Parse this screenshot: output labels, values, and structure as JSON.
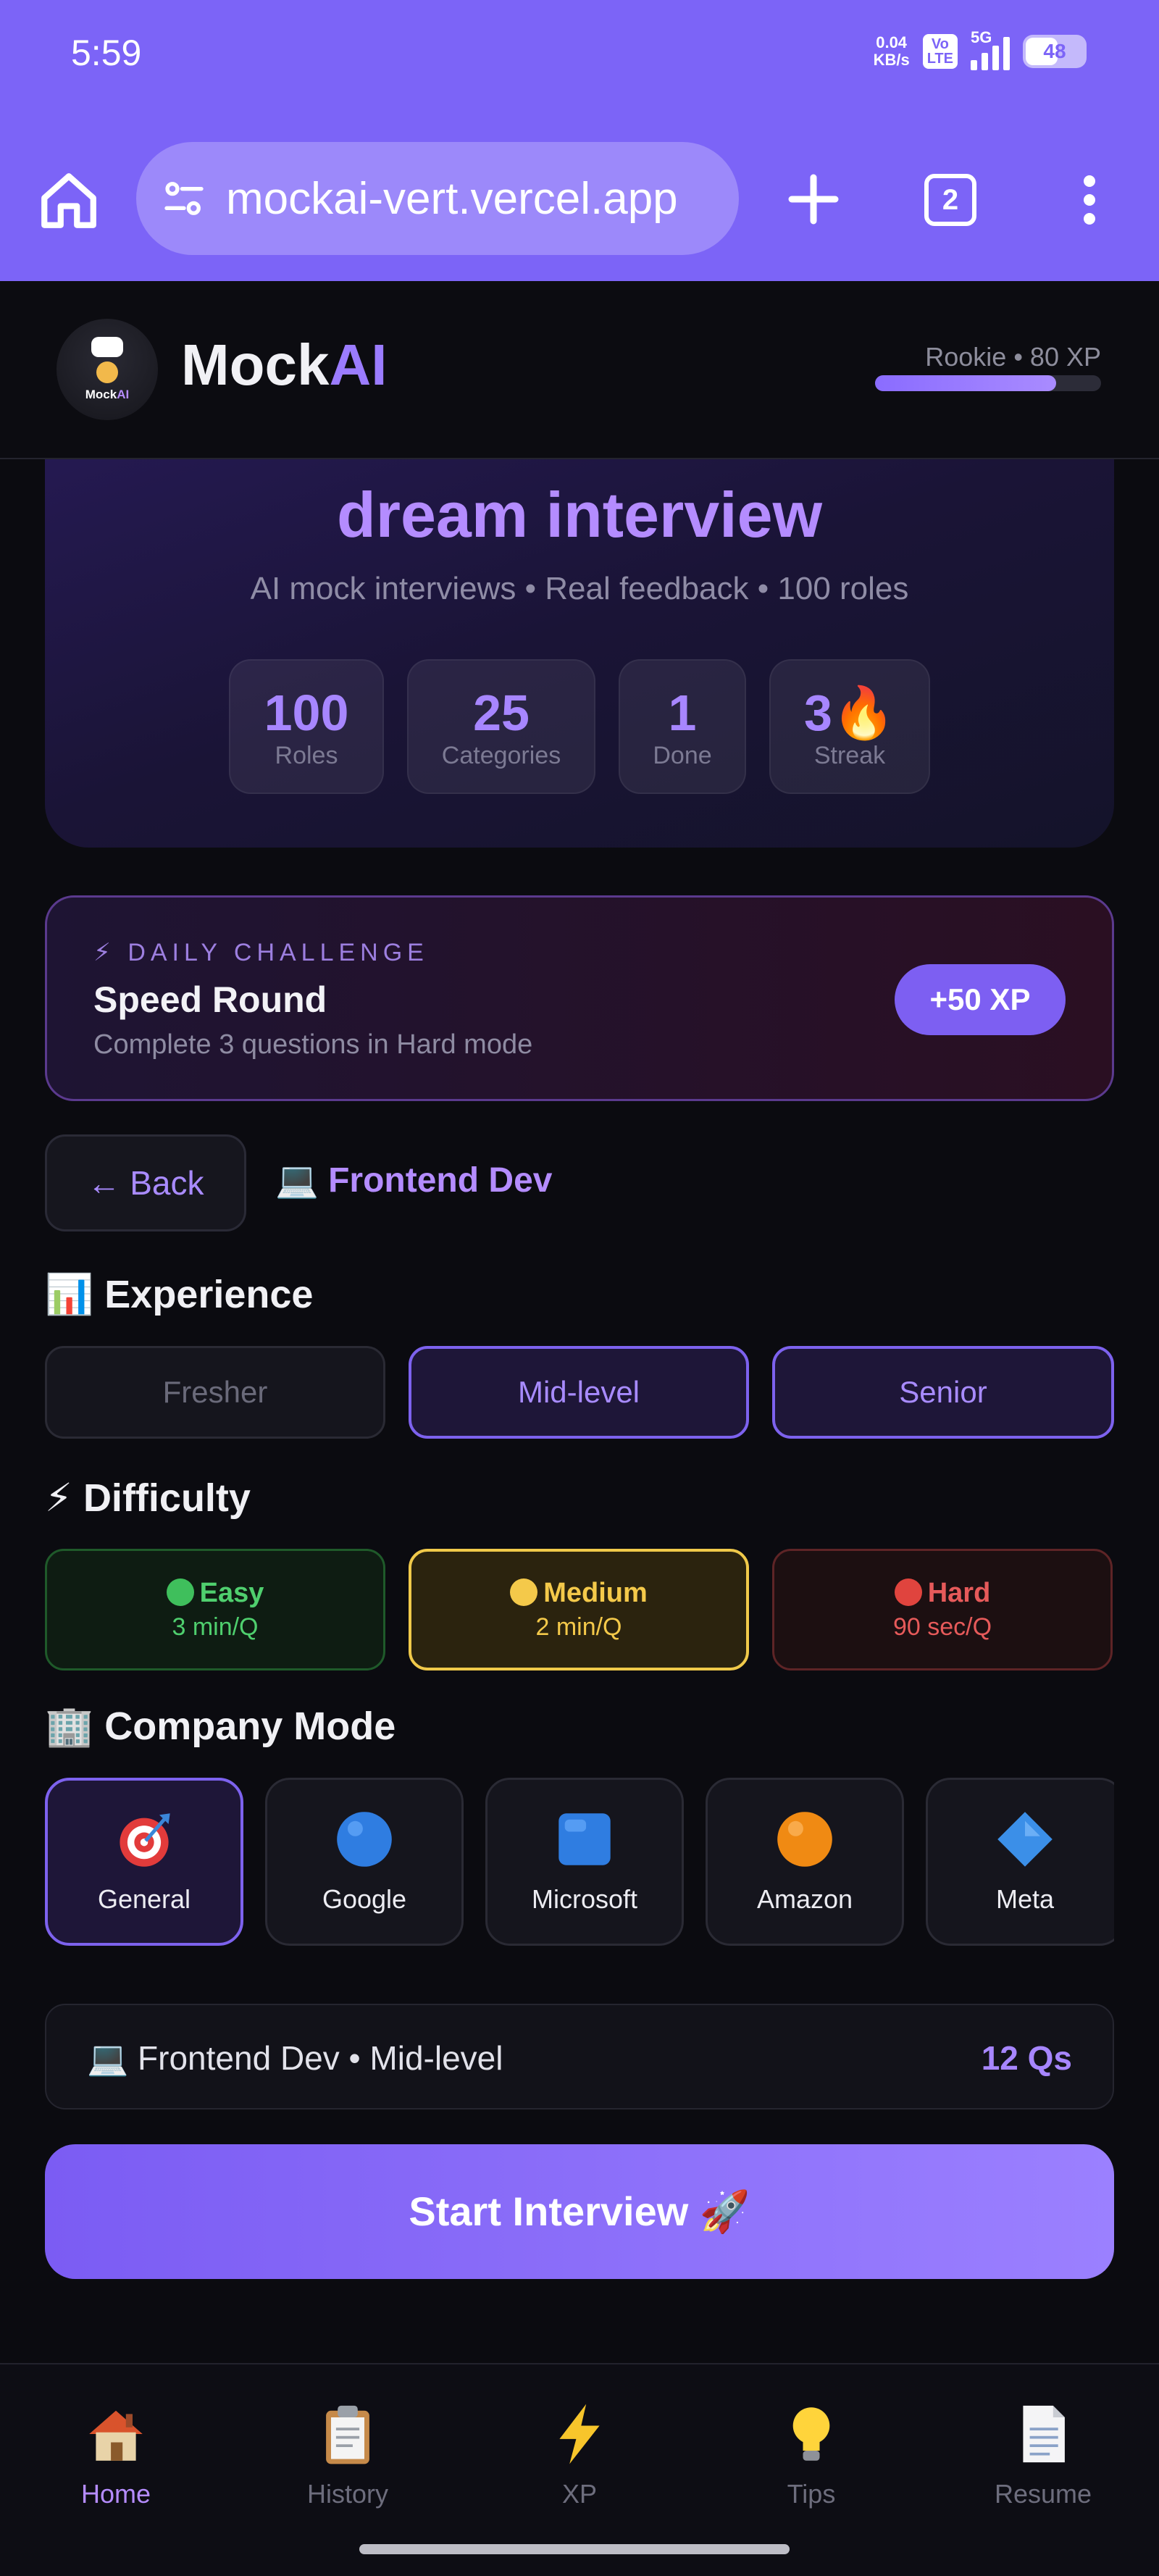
{
  "status_bar": {
    "time": "5:59",
    "net_speed": "0.04",
    "net_unit": "KB/s",
    "volte_top": "Vo",
    "volte_bottom": "LTE",
    "signal": "5G",
    "battery": "48"
  },
  "browser": {
    "url": "mockai-vert.vercel.app",
    "tab_count": "2"
  },
  "app": {
    "brand_prefix": "Mock",
    "brand_suffix": "AI",
    "logo_text_prefix": "Mock",
    "logo_text_suffix": "AI",
    "rank": "Rookie • 80 XP",
    "xp_progress": 0.8
  },
  "hero": {
    "title": "dream interview",
    "subtitle": "AI mock interviews • Real feedback • 100 roles",
    "stats": [
      {
        "value": "100",
        "label": "Roles"
      },
      {
        "value": "25",
        "label": "Categories"
      },
      {
        "value": "1",
        "label": "Done"
      },
      {
        "value": "3🔥",
        "label": "Streak"
      }
    ]
  },
  "challenge": {
    "tag": "⚡ DAILY CHALLENGE",
    "title": "Speed Round",
    "description": "Complete 3 questions in Hard mode",
    "reward": "+50 XP"
  },
  "back": {
    "label": "← Back"
  },
  "role": {
    "icon": "💻",
    "name": "Frontend Dev"
  },
  "experience": {
    "icon": "📊",
    "title": "Experience",
    "options": [
      {
        "label": "Fresher"
      },
      {
        "label": "Mid-level"
      },
      {
        "label": "Senior"
      }
    ]
  },
  "difficulty": {
    "icon": "⚡",
    "title": "Difficulty",
    "options": [
      {
        "name": "Easy",
        "time": "3 min/Q",
        "color": "#3fbf5c"
      },
      {
        "name": "Medium",
        "time": "2 min/Q",
        "color": "#f4c94a"
      },
      {
        "name": "Hard",
        "time": "90 sec/Q",
        "color": "#e0443e"
      }
    ]
  },
  "company": {
    "icon": "🏢",
    "title": "Company Mode",
    "options": [
      {
        "label": "General",
        "icon": "target-icon"
      },
      {
        "label": "Google",
        "icon": "blue-circle-icon"
      },
      {
        "label": "Microsoft",
        "icon": "blue-square-icon"
      },
      {
        "label": "Amazon",
        "icon": "orange-circle-icon"
      },
      {
        "label": "Meta",
        "icon": "blue-diamond-icon"
      }
    ]
  },
  "summary": {
    "left": "💻 Frontend Dev • Mid-level",
    "right": "12 Qs"
  },
  "start": {
    "label": "Start Interview 🚀"
  },
  "nav": [
    {
      "label": "Home",
      "icon": "house-icon"
    },
    {
      "label": "History",
      "icon": "clipboard-icon"
    },
    {
      "label": "XP",
      "icon": "lightning-icon"
    },
    {
      "label": "Tips",
      "icon": "lightbulb-icon"
    },
    {
      "label": "Resume",
      "icon": "document-icon"
    }
  ],
  "colors": {
    "accent": "#7c64f7",
    "accent_light": "#b48cff",
    "background": "#0b0b10"
  }
}
